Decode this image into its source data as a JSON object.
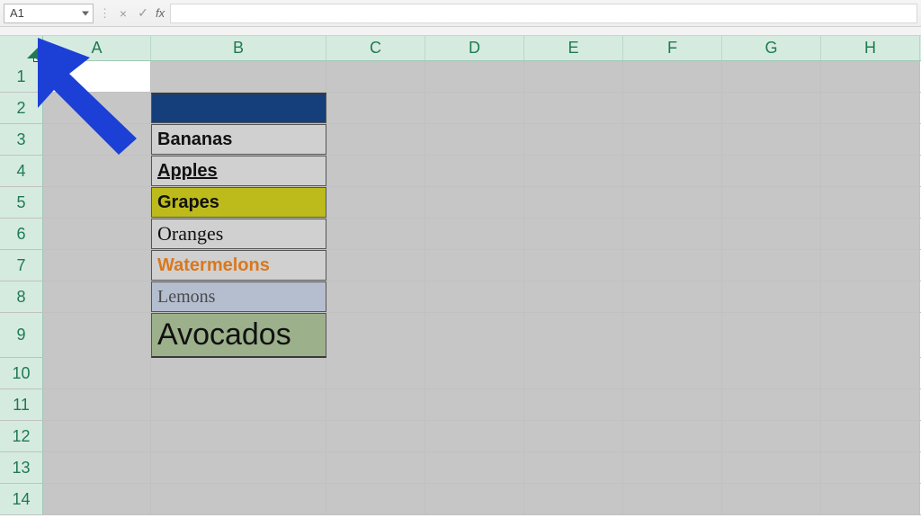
{
  "formula_bar": {
    "name_box_value": "A1",
    "cancel_glyph": "×",
    "enter_glyph": "✓",
    "fx_label": "fx",
    "formula_value": ""
  },
  "columns": [
    "A",
    "B",
    "C",
    "D",
    "E",
    "F",
    "G",
    "H"
  ],
  "rows": [
    "1",
    "2",
    "3",
    "4",
    "5",
    "6",
    "7",
    "8",
    "9",
    "10",
    "11",
    "12",
    "13",
    "14"
  ],
  "select_all_plus": "+",
  "table": {
    "header": "",
    "items": [
      {
        "label": "Bananas"
      },
      {
        "label": "Apples"
      },
      {
        "label": "Grapes"
      },
      {
        "label": "Oranges"
      },
      {
        "label": "Watermelons"
      },
      {
        "label": "Lemons"
      },
      {
        "label": "Avocados"
      }
    ]
  },
  "annotation": {
    "arrow_color": "#1c3fd6"
  }
}
